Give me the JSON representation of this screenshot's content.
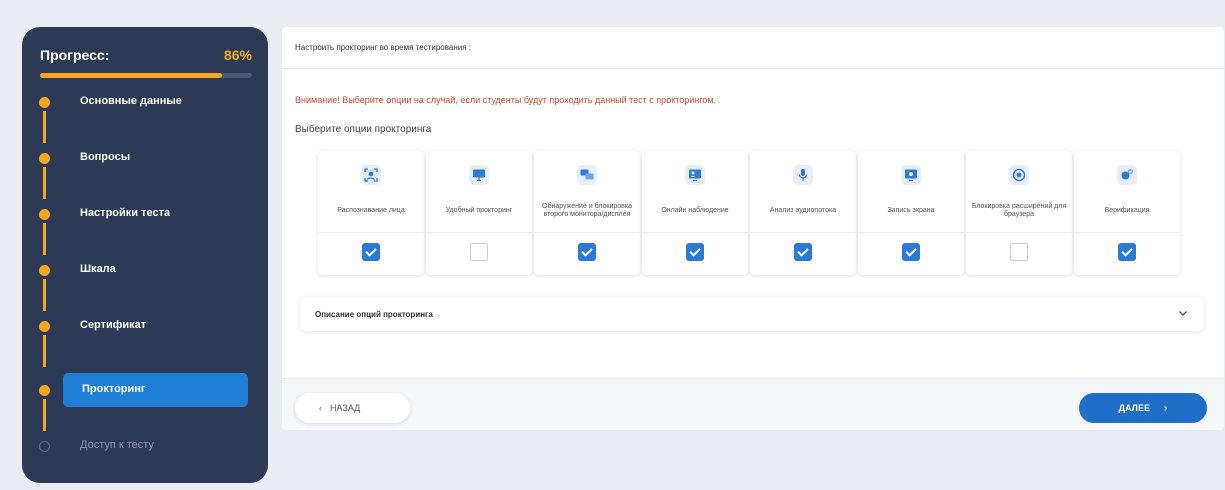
{
  "progress": {
    "label": "Прогресс:",
    "percent_text": "86%",
    "value": 0.86
  },
  "steps": [
    {
      "label": "Основные данные",
      "done": true
    },
    {
      "label": "Вопросы",
      "done": true
    },
    {
      "label": "Настройки теста",
      "done": true
    },
    {
      "label": "Шкала",
      "done": true
    },
    {
      "label": "Сертификат",
      "done": true
    },
    {
      "label": "Прокторинг",
      "done": true,
      "active": true
    },
    {
      "label": "Доступ к тесту",
      "done": false
    }
  ],
  "main": {
    "header": "Настроить прокторинг во время тестирования :",
    "warning": "Внимание! Выберите опции на случай, если студенты будут проходить данный тест с прокторингом.",
    "subtitle": "Выберите опции прокторинга",
    "options": [
      {
        "label": "Распознавание лица",
        "icon": "face-scan-icon",
        "checked": true
      },
      {
        "label": "Удобный прокторинг",
        "icon": "monitor-icon",
        "checked": false
      },
      {
        "label": "Обнаружение и блокировка второго монитора/дисплея",
        "icon": "dual-monitor-icon",
        "checked": true
      },
      {
        "label": "Онлайн наблюдение",
        "icon": "online-monitoring-icon",
        "checked": true
      },
      {
        "label": "Анализ аудиопотока",
        "icon": "microphone-icon",
        "checked": true
      },
      {
        "label": "Запись экрана",
        "icon": "screen-record-icon",
        "checked": true
      },
      {
        "label": "Блокировка расширений для браузера",
        "icon": "browser-block-icon",
        "checked": false
      },
      {
        "label": "Верификация",
        "icon": "verification-icon",
        "checked": true
      }
    ],
    "description_label": "Описание опций прокторинга"
  },
  "footer": {
    "back_label": "НАЗАД",
    "next_label": "ДАЛЕЕ"
  },
  "colors": {
    "accent": "#f5a623",
    "primary": "#1f6fc9",
    "sidebar": "#2d3a55",
    "warning": "#d9462b"
  }
}
